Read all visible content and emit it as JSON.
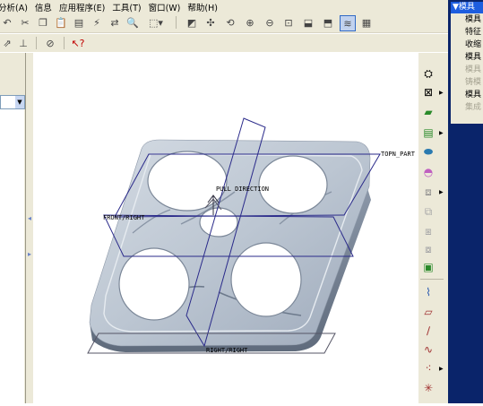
{
  "menubar": {
    "items": [
      "分析(A)",
      "信息",
      "应用程序(E)",
      "工具(T)",
      "窗口(W)",
      "帮助(H)"
    ]
  },
  "model_tree": {
    "combo_value": ""
  },
  "viewport": {
    "labels": {
      "top": "TOPN_PART",
      "pull": "PULL DIRECTION",
      "front": "FRONT/RIGHT",
      "right": "RIGHT/RIGHT"
    }
  },
  "mfg_menu": {
    "title": "▼模具",
    "items": [
      {
        "label": "模具",
        "enabled": true
      },
      {
        "label": "特征",
        "enabled": true
      },
      {
        "label": "收缩",
        "enabled": true
      },
      {
        "label": "模具",
        "enabled": true
      },
      {
        "label": "模具",
        "enabled": false
      },
      {
        "label": "铸模",
        "enabled": false
      },
      {
        "label": "模具",
        "enabled": true
      },
      {
        "label": "集成",
        "enabled": false
      }
    ]
  },
  "colors": {
    "chrome": "#ece9d8",
    "title_blue": "#0a246a",
    "datum_blue": "#2a2a8a",
    "part_gray": "#b8c2cf"
  }
}
